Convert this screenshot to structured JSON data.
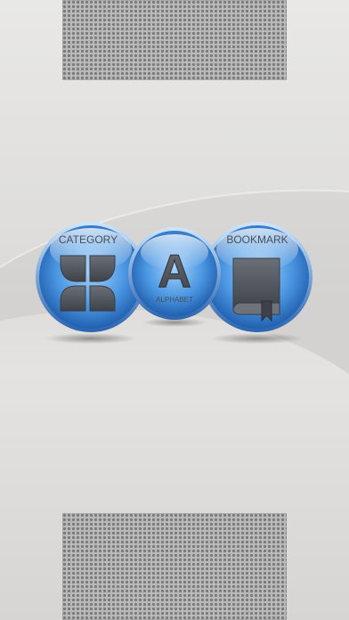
{
  "menu": {
    "category_label": "CATEGORY",
    "alphabet_label": "ALPHABET",
    "alphabet_glyph": "A",
    "bookmark_label": "BOOKMARK"
  },
  "icons": {
    "category": "four-leaf-grid-icon",
    "alphabet": "letter-a-icon",
    "bookmark": "book-bookmark-icon"
  },
  "colors": {
    "orb_light": "#a5d1fa",
    "orb_mid": "#3f8ad8",
    "orb_dark": "#1753a4",
    "glyph": "#4c4f55"
  }
}
